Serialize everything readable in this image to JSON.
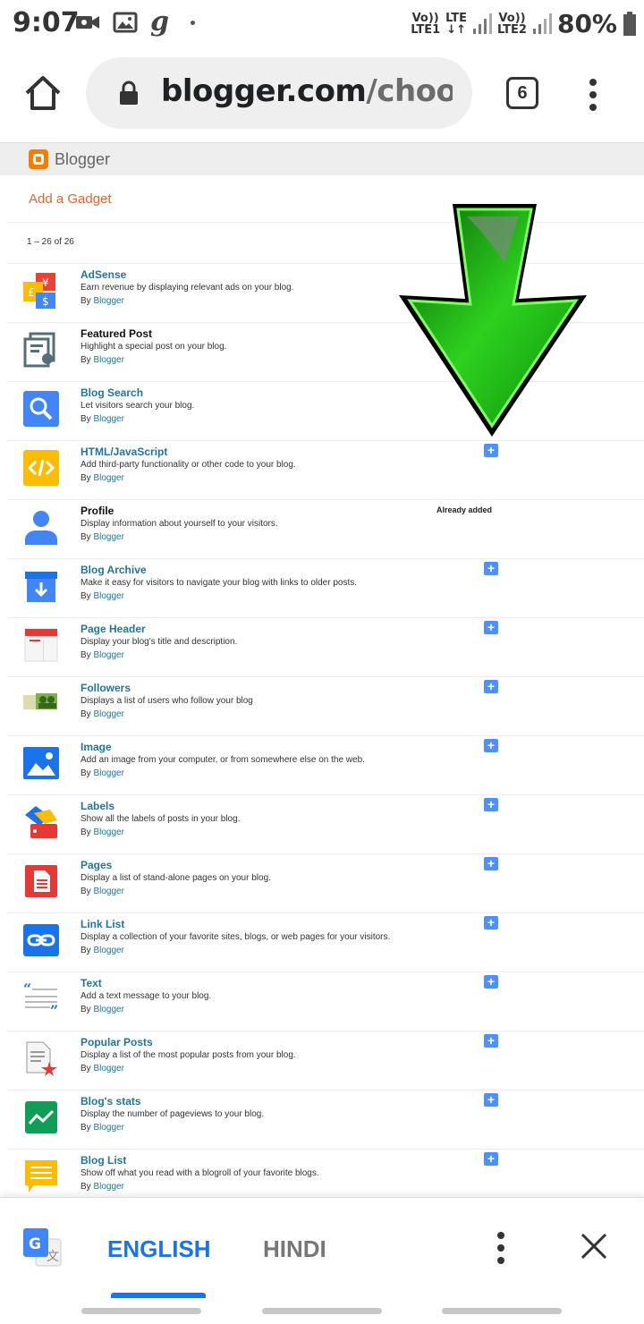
{
  "status_bar": {
    "time": "9:07",
    "carrier_icon_text": "g",
    "sim1_top": "Vo))",
    "sim1_bottom": "LTE1",
    "lte_top": "LTE",
    "lte_bottom": "↓↑",
    "sim2_top": "Vo))",
    "sim2_bottom": "LTE2",
    "battery": "80%"
  },
  "browser": {
    "url_domain": "blogger.com",
    "url_path": "/choose-g",
    "tab_count": "6"
  },
  "blogger": {
    "brand": "Blogger",
    "page_title": "Add a Gadget",
    "count": "1 – 26 of 26"
  },
  "gadgets": [
    {
      "name": "AdSense",
      "desc": "Earn revenue by displaying relevant ads on your blog.",
      "by": "By",
      "author": "Blogger",
      "status": "none",
      "name_style": "link"
    },
    {
      "name": "Featured Post",
      "desc": "Highlight a special post on your blog.",
      "by": "By",
      "author": "Blogger",
      "status": "none",
      "name_style": "dark"
    },
    {
      "name": "Blog Search",
      "desc": "Let visitors search your blog.",
      "by": "By",
      "author": "Blogger",
      "status": "none",
      "name_style": "link"
    },
    {
      "name": "HTML/JavaScript",
      "desc": "Add third-party functionality or other code to your blog.",
      "by": "By",
      "author": "Blogger",
      "status": "add",
      "name_style": "link"
    },
    {
      "name": "Profile",
      "desc": "Display information about yourself to your visitors.",
      "by": "By",
      "author": "Blogger",
      "status": "added",
      "name_style": "dark"
    },
    {
      "name": "Blog Archive",
      "desc": "Make it easy for visitors to navigate your blog with links to older posts.",
      "by": "By",
      "author": "Blogger",
      "status": "add",
      "name_style": "link"
    },
    {
      "name": "Page Header",
      "desc": "Display your blog's title and description.",
      "by": "By",
      "author": "Blogger",
      "status": "add",
      "name_style": "link"
    },
    {
      "name": "Followers",
      "desc": "Displays a list of users who follow your blog",
      "by": "By",
      "author": "Blogger",
      "status": "add",
      "name_style": "link"
    },
    {
      "name": "Image",
      "desc": "Add an image from your computer, or from somewhere else on the web.",
      "by": "By",
      "author": "Blogger",
      "status": "add",
      "name_style": "link"
    },
    {
      "name": "Labels",
      "desc": "Show all the labels of posts in your blog.",
      "by": "By",
      "author": "Blogger",
      "status": "add",
      "name_style": "link"
    },
    {
      "name": "Pages",
      "desc": "Display a list of stand-alone pages on your blog.",
      "by": "By",
      "author": "Blogger",
      "status": "add",
      "name_style": "link"
    },
    {
      "name": "Link List",
      "desc": "Display a collection of your favorite sites, blogs, or web pages for your visitors.",
      "by": "By",
      "author": "Blogger",
      "status": "add",
      "name_style": "link"
    },
    {
      "name": "Text",
      "desc": "Add a text message to your blog.",
      "by": "By",
      "author": "Blogger",
      "status": "add",
      "name_style": "link"
    },
    {
      "name": "Popular Posts",
      "desc": "Display a list of the most popular posts from your blog.",
      "by": "By",
      "author": "Blogger",
      "status": "add",
      "name_style": "link"
    },
    {
      "name": "Blog's stats",
      "desc": "Display the number of pageviews to your blog.",
      "by": "By",
      "author": "Blogger",
      "status": "add",
      "name_style": "link"
    },
    {
      "name": "Blog List",
      "desc": "Show off what you read with a blogroll of your favorite blogs.",
      "by": "By",
      "author": "Blogger",
      "status": "add",
      "name_style": "link"
    }
  ],
  "already_added_label": "Already added",
  "add_symbol": "+",
  "translate": {
    "lang_source": "ENGLISH",
    "lang_target": "HINDI"
  },
  "colors": {
    "link": "#21759b",
    "accent_orange": "#e0662d",
    "add_button": "#4d90fe",
    "translate_active": "#1a73e8",
    "arrow_green": "#22c41a"
  }
}
